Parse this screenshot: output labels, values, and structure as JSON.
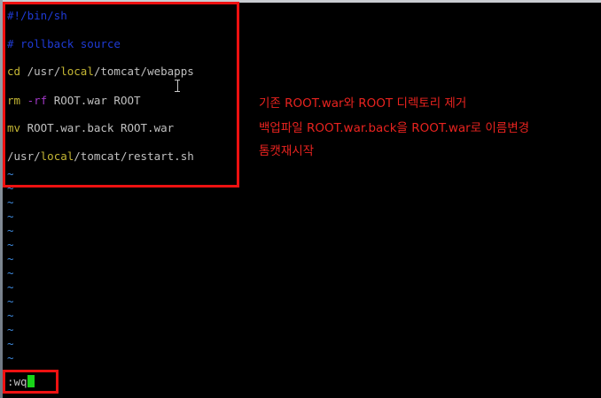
{
  "editor": {
    "lines": {
      "shebang": "#!/bin/sh",
      "comment": "# rollback source",
      "cd_cmd": "cd",
      "cd_usr": " /usr/",
      "cd_local": "local",
      "cd_rest": "/tomcat/webapps",
      "rm_cmd": "rm",
      "rm_flag": " -rf",
      "rm_rest": " ROOT.war ROOT",
      "mv_cmd": "mv",
      "mv_rest": " ROOT.war.back ROOT.war",
      "restart_usr": "/usr/",
      "restart_local": "local",
      "restart_rest": "/tomcat/restart.sh"
    },
    "tilde": "~",
    "command_line": ":wq"
  },
  "annotations": {
    "line1": "기존 ROOT.war와 ROOT 디렉토리 제거",
    "line2": "백업파일 ROOT.war.back을 ROOT.war로 이름변경",
    "line3": "톰캣재시작"
  },
  "colors": {
    "background": "#000000",
    "comment": "#1f3bd6",
    "keyword": "#c4b634",
    "flag": "#a238c8",
    "tilde": "#3f8be0",
    "highlight_box": "#ee1111",
    "annotation_text": "#e8231f",
    "cursor": "#19d419"
  }
}
